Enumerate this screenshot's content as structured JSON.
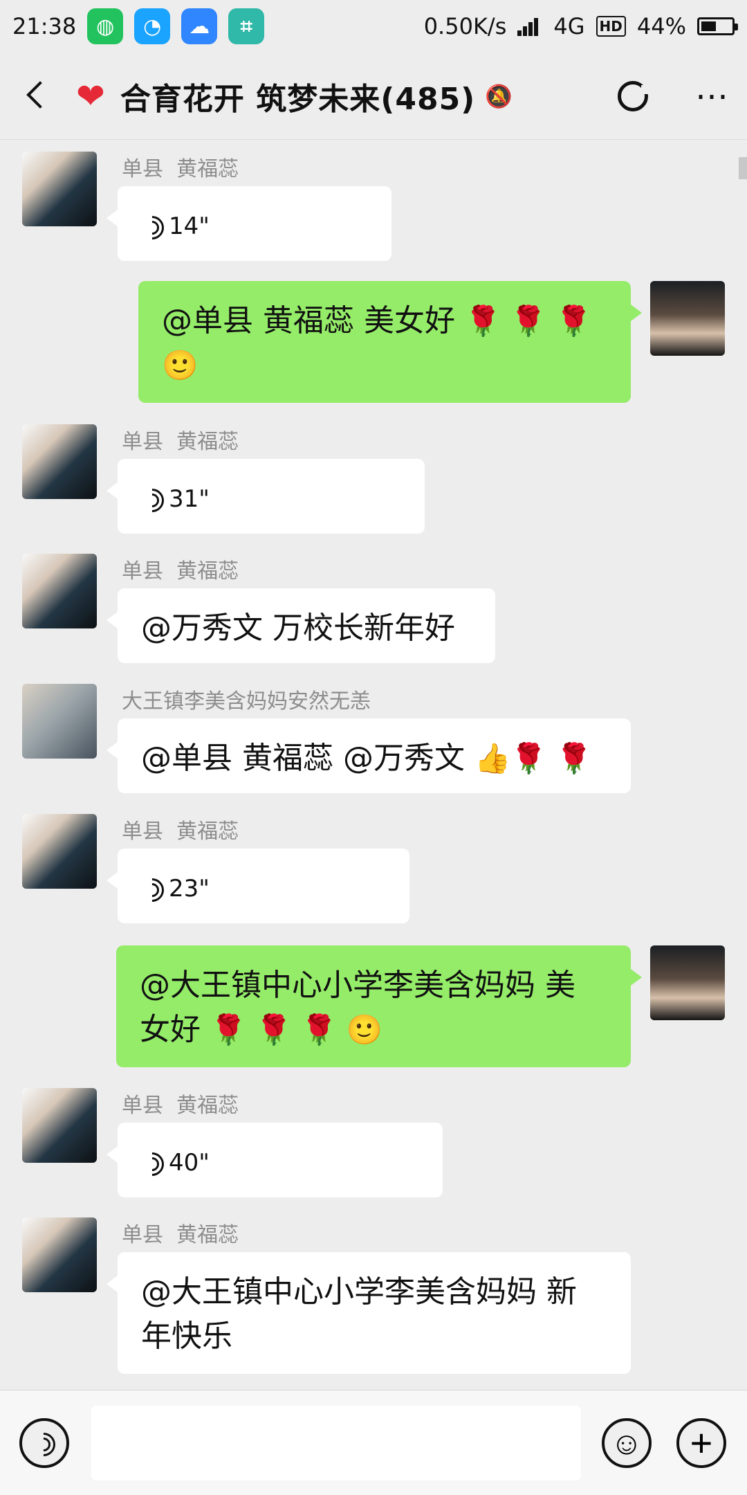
{
  "status": {
    "time": "21:38",
    "network_speed": "0.50K/s",
    "network_label": "4G",
    "hd_label": "HD",
    "battery": "44%",
    "battery_level": 0.44
  },
  "header": {
    "title": "合育花开 筑梦未来(485)",
    "icons": {
      "back": "back-icon",
      "heart": "heart-icon",
      "mute": "mute-icon",
      "refresh": "refresh-icon",
      "more": "more-icon"
    }
  },
  "messages": [
    {
      "sender": "单县  黄福蕊",
      "duration": "14\""
    },
    {
      "text": "@单县  黄福蕊  美女好",
      "emojis": "🌹 🌹 🌹",
      "emoji2": "🙂"
    },
    {
      "sender": "单县  黄福蕊",
      "duration": "31\""
    },
    {
      "sender": "单县  黄福蕊",
      "text": "@万秀文  万校长新年好"
    },
    {
      "sender": "大王镇李美含妈妈安然无恙",
      "text": "@单县  黄福蕊 @万秀文",
      "emojis": "👍🌹 🌹"
    },
    {
      "sender": "单县  黄福蕊",
      "duration": "23\""
    },
    {
      "text_line1": "@大王镇中心小学李美含妈妈  美",
      "text_line2": "女好",
      "emojis": "🌹 🌹 🌹 🙂"
    },
    {
      "sender": "单县  黄福蕊",
      "duration": "40\""
    },
    {
      "sender": "单县  黄福蕊",
      "text_line1": "@大王镇中心小学李美含妈妈  新",
      "text_line2": "年快乐"
    }
  ],
  "input": {
    "placeholder": ""
  }
}
